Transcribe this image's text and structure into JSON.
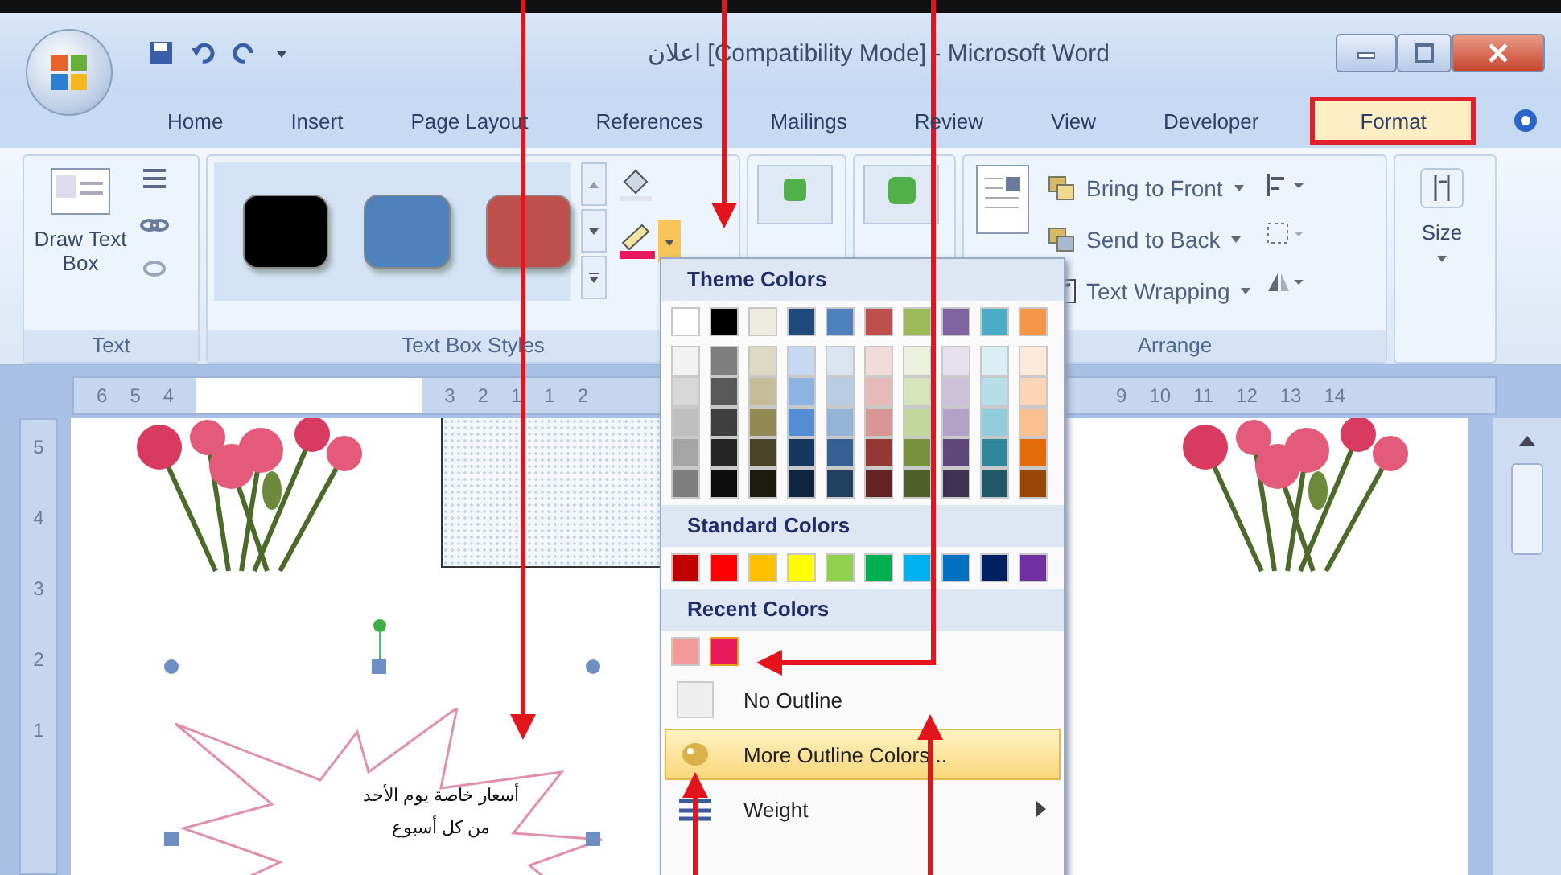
{
  "window": {
    "title": "اعلان [Compatibility Mode] - Microsoft Word"
  },
  "tabs": [
    {
      "label": "Home",
      "selected": false
    },
    {
      "label": "Insert",
      "selected": false
    },
    {
      "label": "Page Layout",
      "selected": false
    },
    {
      "label": "References",
      "selected": false
    },
    {
      "label": "Mailings",
      "selected": false
    },
    {
      "label": "Review",
      "selected": false
    },
    {
      "label": "View",
      "selected": false
    },
    {
      "label": "Developer",
      "selected": false
    },
    {
      "label": "Format",
      "selected": true
    }
  ],
  "text_group": {
    "draw_button": "Draw Text Box",
    "label": "Text"
  },
  "styles_group": {
    "swatches": [
      {
        "color": "#000000"
      },
      {
        "color": "#4f81bd"
      },
      {
        "color": "#c0504d"
      }
    ],
    "label": "Text Box Styles"
  },
  "arrange_group": {
    "commands": [
      {
        "label": "Bring to Front"
      },
      {
        "label": "Send to Back"
      },
      {
        "label": "Text Wrapping"
      }
    ],
    "label": "Arrange"
  },
  "size_group": {
    "label": "Size"
  },
  "ruler": {
    "left_numbers": [
      "6",
      "5",
      "4",
      "3",
      "2",
      "1",
      "1",
      "2"
    ],
    "right_numbers": [
      "9",
      "10",
      "11",
      "12",
      "13",
      "14"
    ]
  },
  "vertical_ruler": [
    "5",
    "4",
    "3",
    "2",
    "1"
  ],
  "document": {
    "shape_text": [
      "أسعار خاصة يوم الأحد",
      "من كل أسبوع"
    ]
  },
  "outline_menu": {
    "theme_header": "Theme Colors",
    "theme_colors": [
      {
        "color": "#ffffff",
        "shades": [
          {
            "color": "#f2f2f2"
          },
          {
            "color": "#d8d8d8"
          },
          {
            "color": "#bfbfbf"
          },
          {
            "color": "#a5a5a5"
          },
          {
            "color": "#7f7f7f"
          }
        ]
      },
      {
        "color": "#000000",
        "shades": [
          {
            "color": "#7f7f7f"
          },
          {
            "color": "#595959"
          },
          {
            "color": "#3f3f3f"
          },
          {
            "color": "#262626"
          },
          {
            "color": "#0c0c0c"
          }
        ]
      },
      {
        "color": "#eeece1",
        "shades": [
          {
            "color": "#ddd9c3"
          },
          {
            "color": "#c4bd97"
          },
          {
            "color": "#938953"
          },
          {
            "color": "#494429"
          },
          {
            "color": "#1d1b10"
          }
        ]
      },
      {
        "color": "#1f497d",
        "shades": [
          {
            "color": "#c6d9f0"
          },
          {
            "color": "#8db3e2"
          },
          {
            "color": "#548dd4"
          },
          {
            "color": "#17365d"
          },
          {
            "color": "#0f243e"
          }
        ]
      },
      {
        "color": "#4f81bd",
        "shades": [
          {
            "color": "#dbe5f1"
          },
          {
            "color": "#b8cce4"
          },
          {
            "color": "#95b3d7"
          },
          {
            "color": "#366092"
          },
          {
            "color": "#244061"
          }
        ]
      },
      {
        "color": "#c0504d",
        "shades": [
          {
            "color": "#f2dcdb"
          },
          {
            "color": "#e5b9b7"
          },
          {
            "color": "#d99694"
          },
          {
            "color": "#953734"
          },
          {
            "color": "#632423"
          }
        ]
      },
      {
        "color": "#9bbb59",
        "shades": [
          {
            "color": "#ebf1dd"
          },
          {
            "color": "#d7e3bc"
          },
          {
            "color": "#c3d69b"
          },
          {
            "color": "#76923c"
          },
          {
            "color": "#4f6128"
          }
        ]
      },
      {
        "color": "#8064a2",
        "shades": [
          {
            "color": "#e5e0ec"
          },
          {
            "color": "#ccc1d9"
          },
          {
            "color": "#b2a2c7"
          },
          {
            "color": "#5f497a"
          },
          {
            "color": "#3f3151"
          }
        ]
      },
      {
        "color": "#4bacc6",
        "shades": [
          {
            "color": "#dbeef3"
          },
          {
            "color": "#b7dde8"
          },
          {
            "color": "#92cddc"
          },
          {
            "color": "#31859b"
          },
          {
            "color": "#205867"
          }
        ]
      },
      {
        "color": "#f79646",
        "shades": [
          {
            "color": "#fdeada"
          },
          {
            "color": "#fbd5b5"
          },
          {
            "color": "#fac08f"
          },
          {
            "color": "#e36c09"
          },
          {
            "color": "#974806"
          }
        ]
      }
    ],
    "standard_header": "Standard Colors",
    "standard_colors": [
      {
        "color": "#c00000"
      },
      {
        "color": "#ff0000"
      },
      {
        "color": "#ffc000"
      },
      {
        "color": "#ffff00"
      },
      {
        "color": "#92d050"
      },
      {
        "color": "#00b050"
      },
      {
        "color": "#00b0f0"
      },
      {
        "color": "#0070c0"
      },
      {
        "color": "#002060"
      },
      {
        "color": "#7030a0"
      }
    ],
    "recent_header": "Recent Colors",
    "recent_colors": [
      {
        "color": "#f29a9a",
        "selected": false
      },
      {
        "color": "#e8195c",
        "selected": true
      }
    ],
    "items": [
      {
        "label": "No Outline",
        "kind": "swatch",
        "highlighted": false
      },
      {
        "label": "More Outline Colors...",
        "kind": "palette",
        "highlighted": true
      },
      {
        "label": "Weight",
        "kind": "submenu",
        "highlighted": false
      }
    ]
  }
}
